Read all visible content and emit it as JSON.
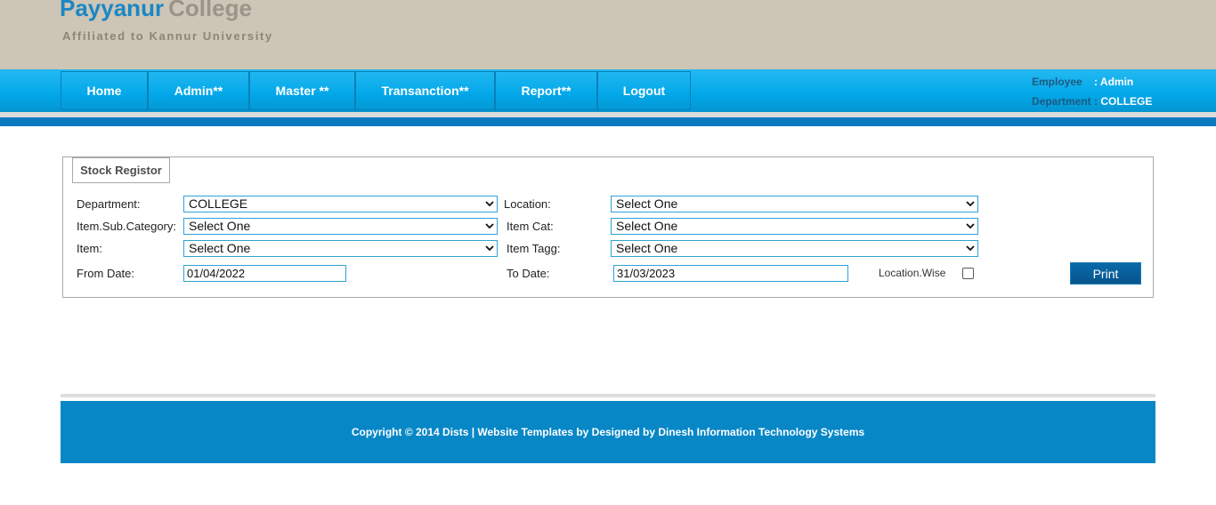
{
  "header": {
    "college_name": "Payyanur",
    "college_word": "College",
    "tagline": "Affiliated to Kannur University"
  },
  "nav": {
    "items": [
      {
        "label": "Home"
      },
      {
        "label": "Admin**"
      },
      {
        "label": "Master **"
      },
      {
        "label": "Transanction**"
      },
      {
        "label": "Report**"
      },
      {
        "label": "Logout"
      }
    ]
  },
  "user": {
    "employee_label": "Employee",
    "employee_value": ": Admin",
    "department_label": "Department :",
    "department_value": "COLLEGE"
  },
  "form": {
    "title": "Stock Registor",
    "department_label": "Department:",
    "department_value": "COLLEGE",
    "location_label": "Location:",
    "location_value": "Select One",
    "subcategory_label": "Item.Sub.Category:",
    "subcategory_value": "Select One",
    "itemcat_label": "Item Cat:",
    "itemcat_value": "Select One",
    "item_label": "Item:",
    "item_value": "Select One",
    "itemtagg_label": "Item Tagg:",
    "itemtagg_value": "Select One",
    "fromdate_label": "From Date:",
    "fromdate_value": "01/04/2022",
    "todate_label": "To Date:",
    "todate_value": "31/03/2023",
    "locationwise_label": "Location.Wise",
    "locationwise_checked": false,
    "print_label": "Print"
  },
  "footer": {
    "text": "Copyright © 2014 Dists | Website Templates by Designed by Dinesh Information Technology Systems"
  },
  "colors": {
    "header_bg": "#cdc5b5",
    "brand_blue": "#1b87c4",
    "nav_blue": "#02a7e8",
    "footer_blue": "#0787c6",
    "button_blue": "#05548d"
  }
}
